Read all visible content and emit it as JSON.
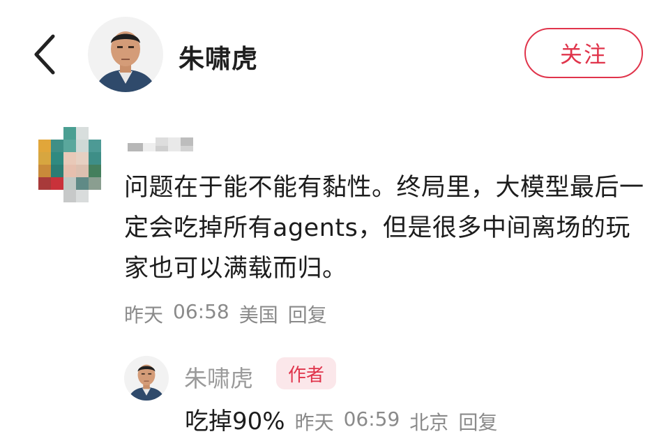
{
  "header": {
    "back_icon": "chevron-left-icon",
    "author_name": "朱啸虎",
    "follow_label": "关注",
    "accent_color": "#e0344b"
  },
  "comment": {
    "avatar": "pixelated-avatar",
    "username": "",
    "text": "问题在于能不能有黏性。终局里，大模型最后一定会吃掉所有agents，但是很多中间离场的玩家也可以满载而归。",
    "date": "昨天",
    "time": "06:58",
    "location": "美国",
    "reply_label": "回复"
  },
  "reply": {
    "name": "朱啸虎",
    "badge": "作者",
    "text": "吃掉90%",
    "date": "昨天",
    "time": "06:59",
    "location": "北京",
    "reply_label": "回复"
  }
}
